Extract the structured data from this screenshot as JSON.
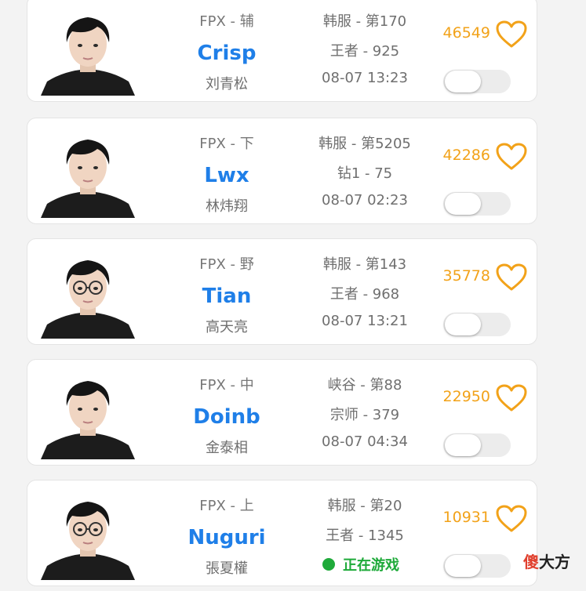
{
  "colors": {
    "accent_blue": "#1f7fe8",
    "likes_orange": "#f2a219",
    "online_green": "#1faa3a",
    "card_bg": "#ffffff",
    "page_bg": "#f3f3f3"
  },
  "players": [
    {
      "team_role": "FPX - 辅",
      "player_id": "Crisp",
      "real_name": "刘青松",
      "server_rank": "韩服 - 第170",
      "tier": "王者 - 925",
      "last_active": "08-07 13:23",
      "status": "",
      "likes": "46549",
      "heart_icon": "heart-outline-icon",
      "toggle_on": false,
      "glasses": false
    },
    {
      "team_role": "FPX - 下",
      "player_id": "Lwx",
      "real_name": "林炜翔",
      "server_rank": "韩服 - 第5205",
      "tier": "钻1 - 75",
      "last_active": "08-07 02:23",
      "status": "",
      "likes": "42286",
      "heart_icon": "heart-outline-icon",
      "toggle_on": false,
      "glasses": false
    },
    {
      "team_role": "FPX - 野",
      "player_id": "Tian",
      "real_name": "高天亮",
      "server_rank": "韩服 - 第143",
      "tier": "王者 - 968",
      "last_active": "08-07 13:21",
      "status": "",
      "likes": "35778",
      "heart_icon": "heart-outline-icon",
      "toggle_on": false,
      "glasses": true
    },
    {
      "team_role": "FPX - 中",
      "player_id": "Doinb",
      "real_name": "金泰相",
      "server_rank": "峡谷 - 第88",
      "tier": "宗师 - 379",
      "last_active": "08-07 04:34",
      "status": "",
      "likes": "22950",
      "heart_icon": "heart-outline-icon",
      "toggle_on": false,
      "glasses": false
    },
    {
      "team_role": "FPX - 上",
      "player_id": "Nuguri",
      "real_name": "張夏權",
      "server_rank": "韩服 - 第20",
      "tier": "王者 - 1345",
      "last_active": "",
      "status": "正在游戏",
      "likes": "10931",
      "heart_icon": "heart-outline-icon",
      "toggle_on": false,
      "glasses": true
    }
  ],
  "watermark": {
    "red": "傻",
    "black": "大方"
  }
}
